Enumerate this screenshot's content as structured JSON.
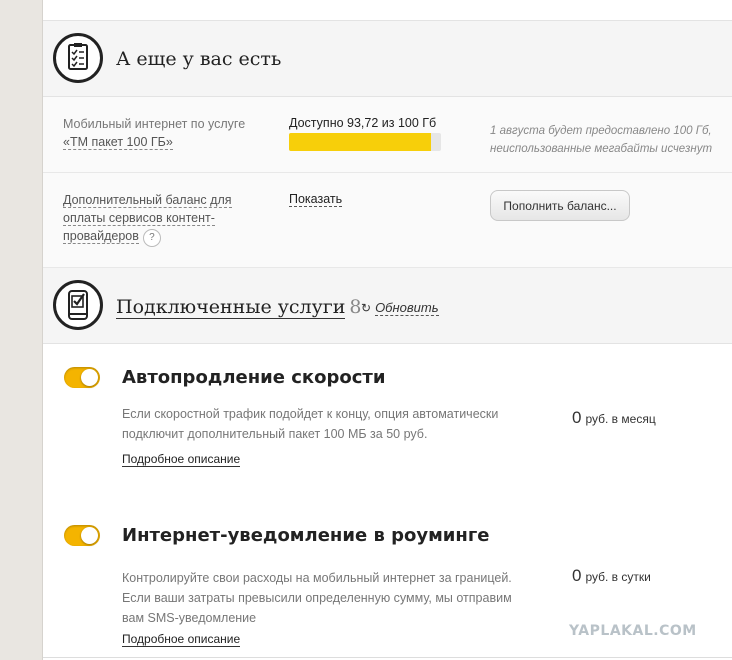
{
  "extras": {
    "title": "А еще у вас есть",
    "internet": {
      "label_line1": "Мобильный интернет по услуге",
      "label_link": "«ТМ пакет 100 ГБ»",
      "available": "Доступно 93,72 из 100 Гб",
      "used_fraction": 0.9372,
      "note_line1": "1 августа будет предоставлено 100 Гб,",
      "note_line2": "неиспользованные мегабайты исчезнут"
    },
    "balance": {
      "label_line1": "Дополнительный баланс для",
      "label_line2": "оплаты сервисов контент-",
      "label_line3": "провайдеров",
      "help": "?",
      "show": "Показать",
      "topup_button": "Пополнить баланс..."
    }
  },
  "services": {
    "title": "Подключенные услуги",
    "count": "8",
    "refresh": "Обновить",
    "refresh_icon": "↻",
    "items": [
      {
        "name": "Автопродление скорости",
        "desc_line1": "Если скоростной трафик подойдет к концу, опция автоматически",
        "desc_line2": "подключит дополнительный пакет 100 МБ за 50 руб.",
        "link": "Подробное описание",
        "price": "0",
        "unit": "руб. в месяц",
        "enabled": true
      },
      {
        "name": "Интернет-уведомление в роуминге",
        "desc_line1": "Контролируйте свои расходы на мобильный интернет за границей.",
        "desc_line2": "Если ваши затраты превысили определенную сумму, мы отправим",
        "desc_line3": "вам SMS-уведомление",
        "link": "Подробное описание",
        "price": "0",
        "unit": "руб. в сутки",
        "enabled": true
      }
    ]
  },
  "watermark": "YAPLAKAL.COM",
  "colors": {
    "accent": "#f4b400",
    "progress": "#f7cf0a"
  }
}
